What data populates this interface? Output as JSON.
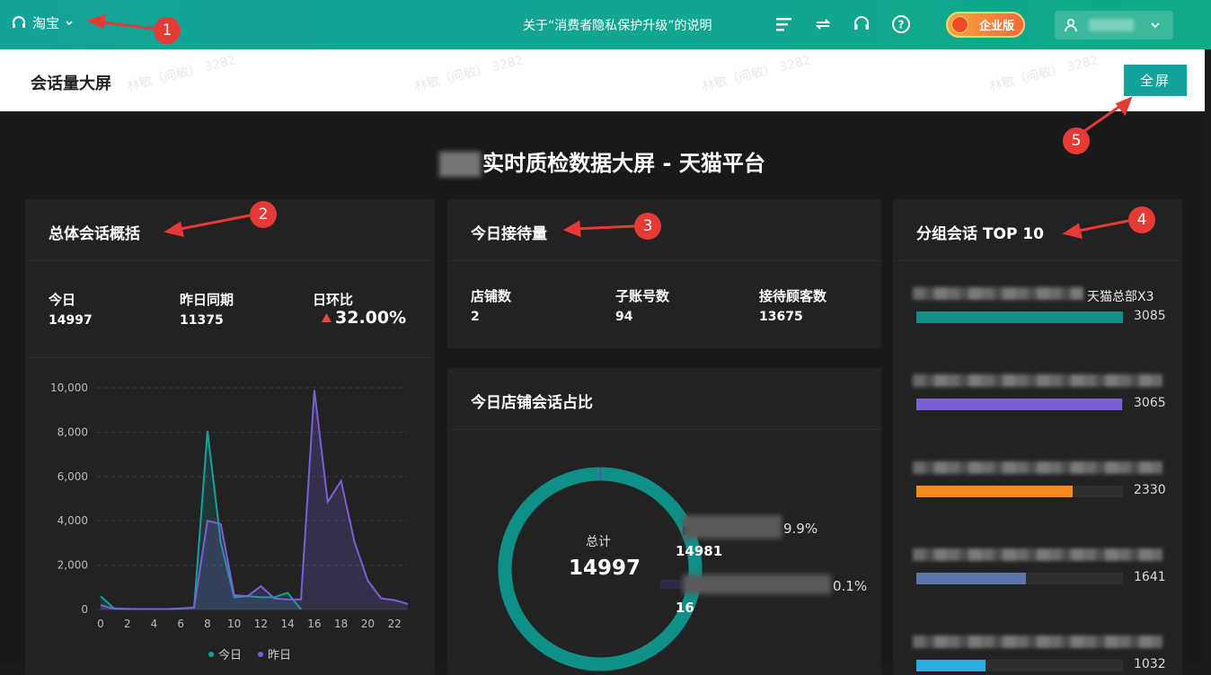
{
  "topbar": {
    "workspace": "淘宝",
    "notice": "关于“消费者隐私保护升级”的说明",
    "enterprise_label": "企业版"
  },
  "header": {
    "title": "会话量大屏",
    "fullscreen_label": "全屏",
    "watermark": "林敏（问敏） 3282"
  },
  "dashboard": {
    "title": "实时质检数据大屏 - 天猫平台"
  },
  "overview": {
    "title": "总体会话概括",
    "today_label": "今日",
    "today_value": "14997",
    "yesterday_label": "昨日同期",
    "yesterday_value": "11375",
    "ratio_label": "日环比",
    "ratio_value": "32.00%",
    "legend_today": "今日",
    "legend_yesterday": "昨日"
  },
  "reception": {
    "title": "今日接待量",
    "shops_label": "店铺数",
    "shops_value": "2",
    "subaccounts_label": "子账号数",
    "subaccounts_value": "94",
    "customers_label": "接待顾客数",
    "customers_value": "13675"
  },
  "share": {
    "title": "今日店铺会话占比",
    "total_label": "总计",
    "total_value": "14997",
    "seg1_pct": "9.9%",
    "seg1_value": "14981",
    "seg2_pct": "0.1%",
    "seg2_value": "16"
  },
  "top10": {
    "title": "分组会话 TOP 10",
    "first_label_suffix": "天猫总部X3",
    "items": [
      {
        "value": "3085",
        "color": "#0e8f88",
        "fraction": 1.0
      },
      {
        "value": "3065",
        "color": "#7a5fd6",
        "fraction": 0.994
      },
      {
        "value": "2330",
        "color": "#f58a1f",
        "fraction": 0.755
      },
      {
        "value": "1641",
        "color": "#5d75a8",
        "fraction": 0.532
      },
      {
        "value": "1032",
        "color": "#2aaee0",
        "fraction": 0.335
      }
    ]
  },
  "annotations": [
    "1",
    "2",
    "3",
    "4",
    "5"
  ],
  "chart_data": {
    "type": "line",
    "x": [
      0,
      1,
      2,
      3,
      4,
      5,
      6,
      7,
      8,
      9,
      10,
      11,
      12,
      13,
      14,
      15,
      16,
      17,
      18,
      19,
      20,
      21,
      22,
      23
    ],
    "xticks": [
      "0",
      "2",
      "4",
      "6",
      "8",
      "10",
      "12",
      "14",
      "16",
      "18",
      "20",
      "22"
    ],
    "yticks": [
      "0",
      "2,000",
      "4,000",
      "6,000",
      "8,000",
      "10,000"
    ],
    "ylim": [
      0,
      10000
    ],
    "series": [
      {
        "name": "今日",
        "color": "#14a39a",
        "values": [
          600,
          50,
          30,
          20,
          20,
          20,
          50,
          80,
          8050,
          3000,
          550,
          600,
          550,
          550,
          750,
          0,
          null,
          null,
          null,
          null,
          null,
          null,
          null,
          null
        ]
      },
      {
        "name": "昨日",
        "color": "#7a5fd6",
        "values": [
          200,
          30,
          20,
          20,
          20,
          20,
          30,
          100,
          4000,
          3850,
          650,
          600,
          1050,
          500,
          450,
          450,
          9900,
          4850,
          5800,
          3050,
          1300,
          500,
          420,
          250
        ]
      }
    ]
  }
}
